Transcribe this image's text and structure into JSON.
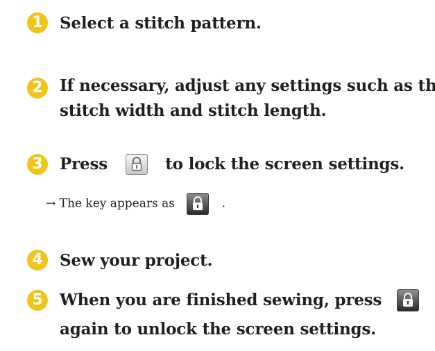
{
  "steps": [
    {
      "num": "1",
      "lines": [
        "Select a stitch pattern."
      ]
    },
    {
      "num": "2",
      "lines": [
        "If necessary, adjust any settings such as the",
        "stitch width and stitch length."
      ]
    },
    {
      "num": "3",
      "before": "Press",
      "after": "to lock the screen settings.",
      "icon": "lock-key-icon"
    },
    {
      "num": "4",
      "lines": [
        "Sew your project."
      ]
    },
    {
      "num": "5",
      "before": "When you are finished sewing, press",
      "line2": "again to unlock the screen settings.",
      "icon": "lock-key-active-icon"
    }
  ],
  "note": {
    "arrow": "→",
    "text": "The key appears as",
    "trail": ".",
    "icon": "lock-key-active-icon"
  },
  "colors": {
    "step_number_bg": "#f0c419",
    "text": "#231f20",
    "key_inactive": "#d9d9d9",
    "key_active": "#3a3a3a"
  }
}
